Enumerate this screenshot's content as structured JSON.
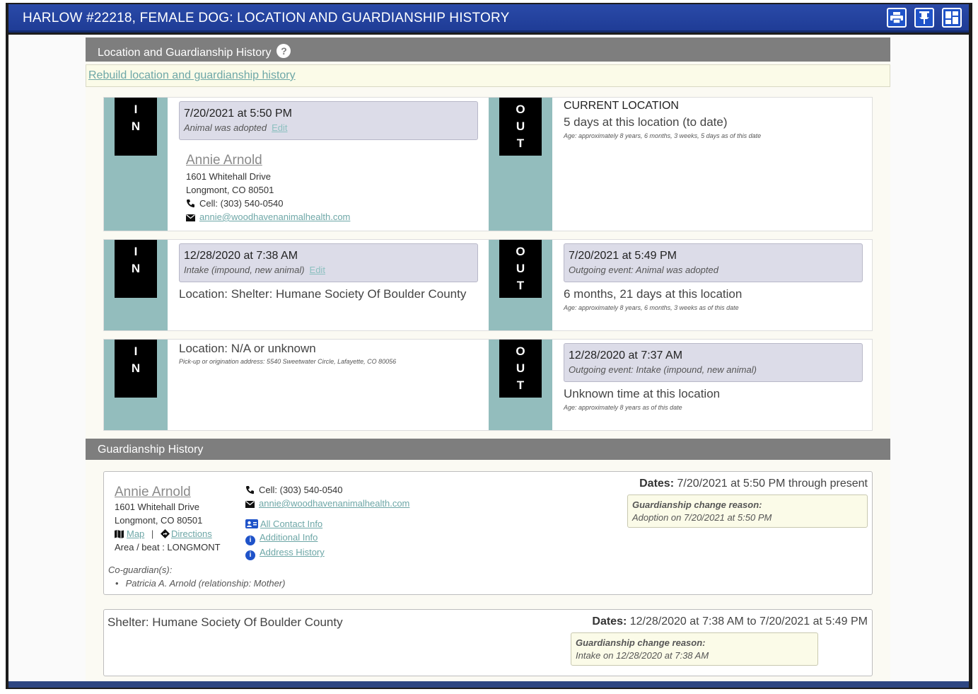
{
  "window": {
    "title": "HARLOW #22218, FEMALE DOG: LOCATION AND GUARDIANSHIP HISTORY",
    "buttons": [
      "print-icon",
      "pin-icon",
      "layout-icon"
    ]
  },
  "location_section": {
    "heading": "Location and Guardianship History",
    "help_glyph": "?",
    "rebuild_link": "Rebuild location and guardianship history"
  },
  "badges": {
    "in": [
      "I",
      "N"
    ],
    "out": [
      "O",
      "U",
      "T"
    ]
  },
  "rows": [
    {
      "in": {
        "date": "7/20/2021 at 5:50 PM",
        "event": "Animal was adopted",
        "edit": "Edit",
        "person": {
          "name": "Annie Arnold",
          "address1": "1601 Whitehall Drive",
          "address2": "Longmont, CO 80501",
          "cell": "Cell: (303) 540-0540",
          "email": "annie@woodhavenanimalhealth.com"
        }
      },
      "out": {
        "heading": "CURRENT LOCATION",
        "duration": "5 days at this location (to date)",
        "age": "Age: approximately 8 years, 6 months, 3 weeks, 5 days as of this date"
      }
    },
    {
      "in": {
        "date": "12/28/2020 at 7:38 AM",
        "event": "Intake (impound, new animal)",
        "edit": "Edit",
        "location": "Location: Shelter: Humane Society Of Boulder County"
      },
      "out": {
        "date": "7/20/2021 at 5:49 PM",
        "event": "Outgoing event: Animal was adopted",
        "duration": "6 months, 21 days at this location",
        "age": "Age: approximately 8 years, 6 months, 3 weeks as of this date"
      }
    },
    {
      "in": {
        "location": "Location: N/A or unknown",
        "pickup": "Pick-up or origination address: 5540 Sweetwater Circle, Lafayette, CO 80056"
      },
      "out": {
        "date": "12/28/2020 at 7:37 AM",
        "event": "Outgoing event: Intake (impound, new animal)",
        "duration": "Unknown time at this location",
        "age": "Age: approximately 8 years as of this date"
      }
    }
  ],
  "guardianship_section": {
    "heading": "Guardianship History",
    "cards": [
      {
        "name": "Annie Arnold",
        "address1": "1601 Whitehall Drive",
        "address2": "Longmont, CO 80501",
        "map": "Map",
        "separator": "|",
        "directions": "Directions",
        "area": "Area / beat : LONGMONT",
        "cell": "Cell: (303) 540-0540",
        "email": "annie@woodhavenanimalhealth.com",
        "all_contact": "All Contact Info",
        "additional_info": "Additional Info",
        "address_history": "Address History",
        "dates_label": "Dates:",
        "dates_value": "7/20/2021 at 5:50 PM through present",
        "reason_label": "Guardianship change reason:",
        "reason_value": "Adoption on 7/20/2021 at 5:50 PM",
        "coguardians_label": "Co-guardian(s):",
        "coguardians": [
          "Patricia A. Arnold (relationship: Mother)"
        ]
      },
      {
        "name": "Shelter: Humane Society Of Boulder County",
        "dates_label": "Dates:",
        "dates_value": "12/28/2020 at 7:38 AM to 7/20/2021 at 5:49 PM",
        "reason_label": "Guardianship change reason:",
        "reason_value": "Intake on 12/28/2020 at 7:38 AM"
      }
    ]
  },
  "colors": {
    "titlebar": "#2a4aa8",
    "section_header": "#7e7e7e",
    "teal_strip": "#93bdbd",
    "event_box": "#dcdce8",
    "link_teal": "#6ea7a7"
  }
}
